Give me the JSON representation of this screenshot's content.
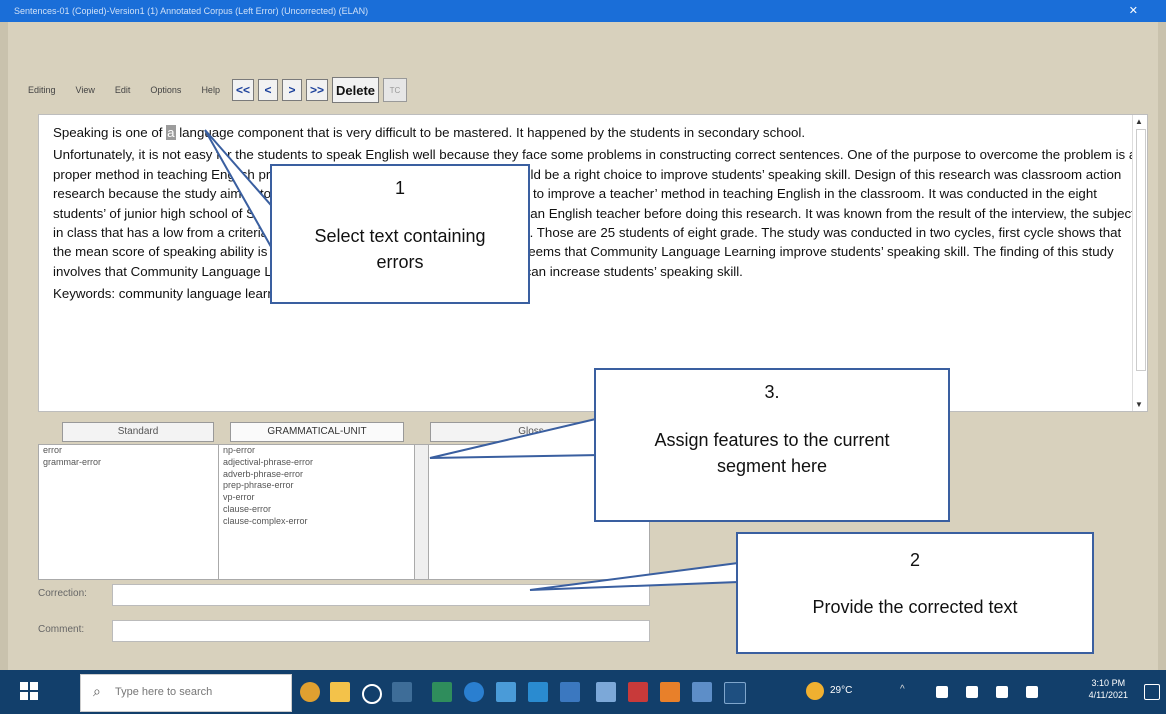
{
  "window": {
    "title": "Sentences-01 (Copied)-Version1 (1) Annotated Corpus (Left Error) (Uncorrected) (ELAN)",
    "close_icon": "close-icon"
  },
  "menu": {
    "items": [
      "Editing",
      "View",
      "Edit",
      "Options",
      "Help"
    ]
  },
  "nav": {
    "first": "<<",
    "prev": "<",
    "next": ">",
    "last": ">>",
    "delete": "Delete",
    "extra": "TC"
  },
  "text": {
    "highlight": "a",
    "p1_before": "Speaking is one of ",
    "p1_after": " language component that is very difficult to be mastered. It happened by the students in secondary school.",
    "p2": "Unfortunately, it is not easy for the students to speak English well because they face some problems in constructing correct sentences. One of the purpose to overcome the problem is a proper method in teaching English process. Community Language Learning should be a right choice to improve students’ speaking skill. Design of this research was classroom action research because the study aimed to escape students’ problems in speaking and to improve a teacher’ method in teaching English in the classroom. It was conducted in the eight students’ of junior high school of SMP N 1 Pasirlado. The researcher interviewed an English teacher before doing this research. It was known from the result of the interview, the subject in class that has a low from a criteria minimum 70 in speaking activity in the class. Those are 25 students of eight grade. The study was conducted in two cycles, first cycle shows that the mean score of speaking ability is 81,25% and the second cycle is 87,5 %. It seems that Community Language Learning improve students’ speaking skill. The finding of this study involves that Community Language Learning become a method of teaching that can increase students’ speaking skill.",
    "p3": "Keywords: community language learning, speaking skill, speaking competence"
  },
  "panes": {
    "standard_header": "Standard",
    "grammatical_header": "GRAMMATICAL-UNIT",
    "gloss_header": "Gloss",
    "standard_items": [
      "error",
      "grammar-error"
    ],
    "grammatical_items": [
      "np-error",
      "adjectival-phrase-error",
      "adverb-phrase-error",
      "prep-phrase-error",
      "vp-error",
      "clause-error",
      "clause-complex-error"
    ]
  },
  "fields": {
    "correction_label": "Correction:",
    "comment_label": "Comment:",
    "correction_value": "",
    "comment_value": ""
  },
  "callouts": {
    "c1_num": "1",
    "c1_text": "Select text containing errors",
    "c2_num": "2",
    "c2_text": "Provide the corrected text",
    "c3_num": "3.",
    "c3_text": "Assign features to the current segment here"
  },
  "taskbar": {
    "search_placeholder": "Type here to search",
    "weather": "29°C",
    "time": "3:10 PM",
    "date": "4/11/2021"
  },
  "colors": {
    "callout_border": "#3a5fa0",
    "titlebar": "#1a6ed8",
    "taskbar": "#123f6b"
  }
}
